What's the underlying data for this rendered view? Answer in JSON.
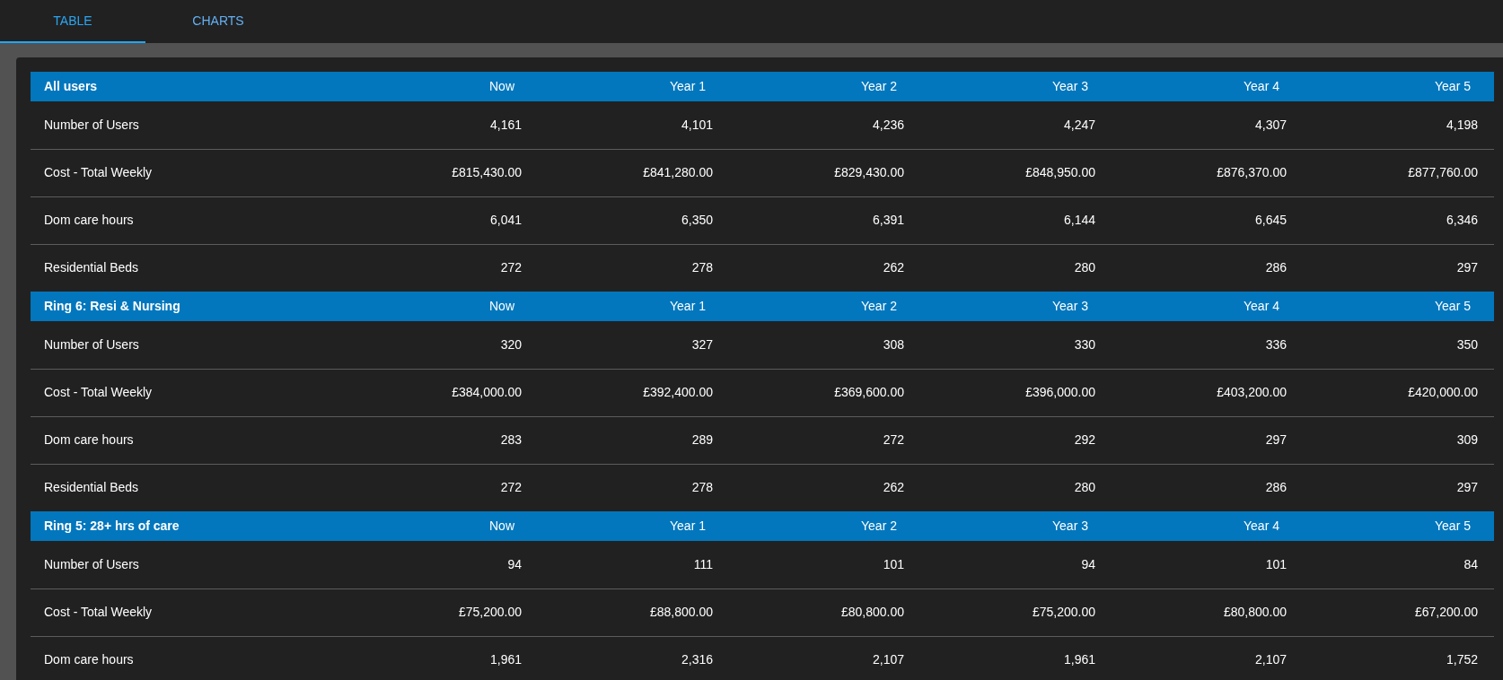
{
  "tabs": [
    {
      "label": "TABLE",
      "selected": true
    },
    {
      "label": "CHARTS",
      "selected": false
    }
  ],
  "groups": [
    {
      "title": "All users",
      "columns": [
        "Now",
        "Year 1",
        "Year 2",
        "Year 3",
        "Year 4",
        "Year 5"
      ],
      "rows": [
        {
          "label": "Number of Users",
          "values": [
            "4,161",
            "4,101",
            "4,236",
            "4,247",
            "4,307",
            "4,198"
          ]
        },
        {
          "label": "Cost - Total Weekly",
          "values": [
            "£815,430.00",
            "£841,280.00",
            "£829,430.00",
            "£848,950.00",
            "£876,370.00",
            "£877,760.00"
          ]
        },
        {
          "label": "Dom care hours",
          "values": [
            "6,041",
            "6,350",
            "6,391",
            "6,144",
            "6,645",
            "6,346"
          ]
        },
        {
          "label": "Residential Beds",
          "values": [
            "272",
            "278",
            "262",
            "280",
            "286",
            "297"
          ]
        }
      ]
    },
    {
      "title": "Ring 6: Resi & Nursing",
      "columns": [
        "Now",
        "Year 1",
        "Year 2",
        "Year 3",
        "Year 4",
        "Year 5"
      ],
      "rows": [
        {
          "label": "Number of Users",
          "values": [
            "320",
            "327",
            "308",
            "330",
            "336",
            "350"
          ]
        },
        {
          "label": "Cost - Total Weekly",
          "values": [
            "£384,000.00",
            "£392,400.00",
            "£369,600.00",
            "£396,000.00",
            "£403,200.00",
            "£420,000.00"
          ]
        },
        {
          "label": "Dom care hours",
          "values": [
            "283",
            "289",
            "272",
            "292",
            "297",
            "309"
          ]
        },
        {
          "label": "Residential Beds",
          "values": [
            "272",
            "278",
            "262",
            "280",
            "286",
            "297"
          ]
        }
      ]
    },
    {
      "title": "Ring 5: 28+ hrs of care",
      "columns": [
        "Now",
        "Year 1",
        "Year 2",
        "Year 3",
        "Year 4",
        "Year 5"
      ],
      "rows": [
        {
          "label": "Number of Users",
          "values": [
            "94",
            "111",
            "101",
            "94",
            "101",
            "84"
          ]
        },
        {
          "label": "Cost - Total Weekly",
          "values": [
            "£75,200.00",
            "£88,800.00",
            "£80,800.00",
            "£75,200.00",
            "£80,800.00",
            "£67,200.00"
          ]
        },
        {
          "label": "Dom care hours",
          "values": [
            "1,961",
            "2,316",
            "2,107",
            "1,961",
            "2,107",
            "1,752"
          ]
        }
      ]
    }
  ]
}
